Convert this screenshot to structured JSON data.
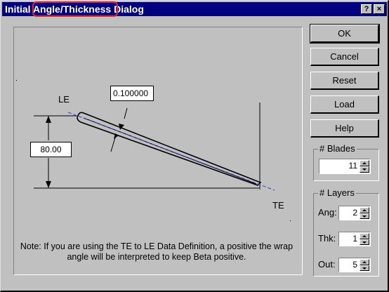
{
  "window": {
    "title_prefix": "Initial ",
    "title_main": "Angle/Thickness",
    "title_suffix": " Dialog",
    "help_glyph": "?",
    "close_glyph": "×"
  },
  "diagram": {
    "thickness_value": "0.100000",
    "angle_value": "80.00",
    "le_label": "LE",
    "te_label": "TE",
    "note": "Note: If you are using the TE to LE Data Definition, a positive the wrap angle will be interpreted to keep Beta positive."
  },
  "buttons": {
    "ok": "OK",
    "cancel": "Cancel",
    "reset": "Reset",
    "load": "Load",
    "help": "Help"
  },
  "blades": {
    "title": "# Blades",
    "value": "11"
  },
  "layers": {
    "title": "# Layers",
    "ang_label": "Ang:",
    "ang_value": "2",
    "thk_label": "Thk:",
    "thk_value": "1",
    "out_label": "Out:",
    "out_value": "5"
  },
  "colors": {
    "titlebar": "#000080",
    "highlight": "#e8262b",
    "camber_line": "#3b3bd0"
  }
}
